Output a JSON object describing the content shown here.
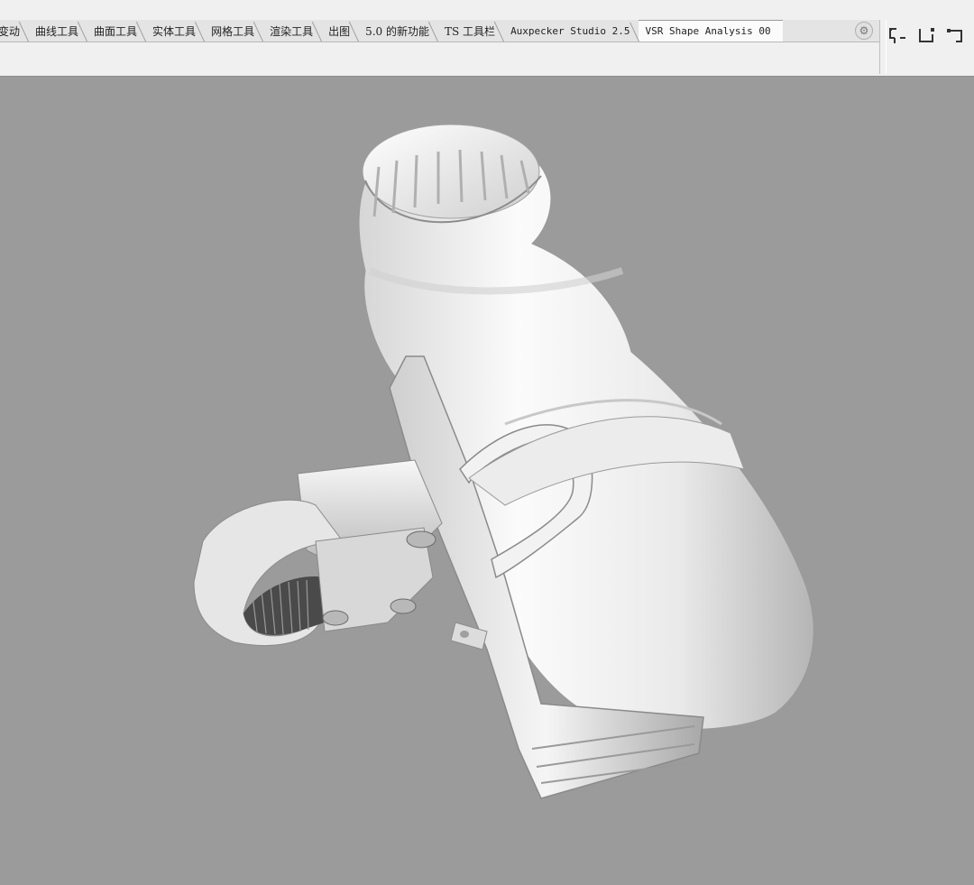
{
  "toolbar": {
    "tabs": [
      {
        "label": "变动"
      },
      {
        "label": "曲线工具"
      },
      {
        "label": "曲面工具"
      },
      {
        "label": "实体工具"
      },
      {
        "label": "网格工具"
      },
      {
        "label": "渲染工具"
      },
      {
        "label": "出图"
      },
      {
        "label": "5.0 的新功能"
      },
      {
        "label": "TS 工具栏"
      },
      {
        "label": "Auxpecker Studio 2.5"
      },
      {
        "label": "VSR Shape Analysis 00"
      }
    ],
    "active_tab": "VSR Shape Analysis 00",
    "tool_icons": [
      "polyline-left-icon",
      "polyline-mid-icon",
      "polyline-right-icon",
      "polyline-extra-icon"
    ]
  },
  "viewport": {
    "background": "#9b9b9b",
    "object": "bottle-with-handlebar-cage-render"
  }
}
